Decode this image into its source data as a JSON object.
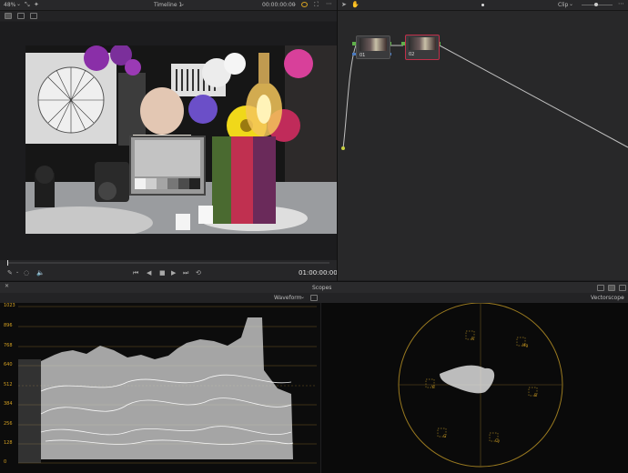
{
  "viewer": {
    "zoom": "48%",
    "timeline_name": "Timeline 1",
    "timecode_top": "00:00:00:00",
    "timecode_bottom": "01:00:00:00"
  },
  "node_editor": {
    "mode_label": "Clip",
    "nodes": [
      {
        "label": "01"
      },
      {
        "label": "02"
      }
    ]
  },
  "scopes": {
    "title": "Scopes",
    "left_scope": "Waveform",
    "right_scope": "Vectorscope",
    "waveform_scale": [
      "1023",
      "896",
      "768",
      "640",
      "512",
      "384",
      "256",
      "128",
      "0"
    ],
    "vector_targets": [
      "R",
      "Mg",
      "B",
      "Cy",
      "G",
      "Yl"
    ]
  },
  "colors": {
    "accent_gold": "#d4a021",
    "node_link": "#bfbfbf",
    "selected_node": "#c0304a"
  }
}
